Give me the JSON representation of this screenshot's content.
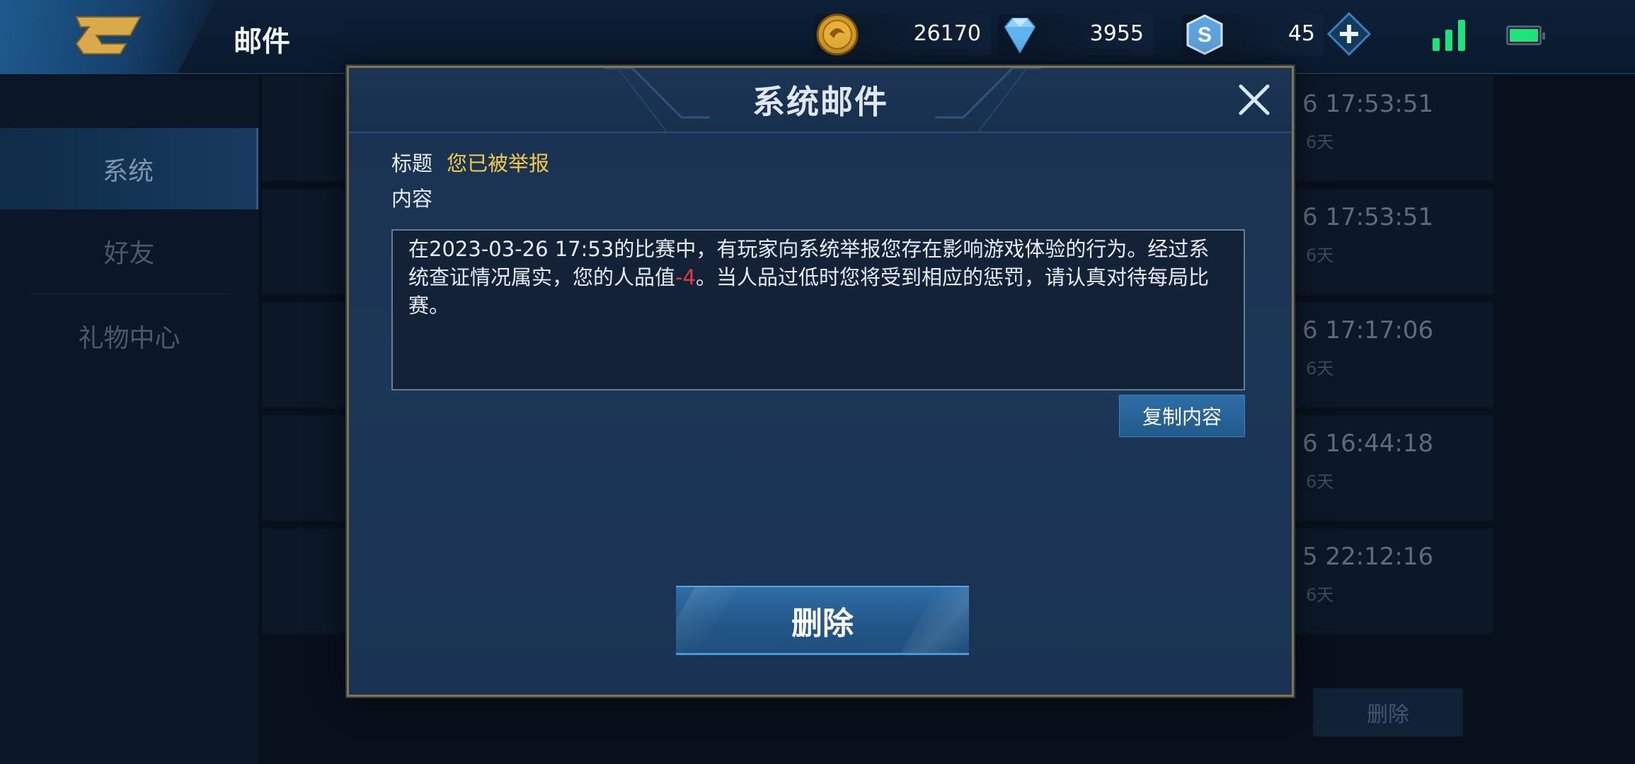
{
  "topbar": {
    "title": "邮件",
    "gold": "26170",
    "diamonds": "3955",
    "vouchers": "45"
  },
  "sidebar": {
    "items": [
      {
        "label": "系统",
        "active": true
      },
      {
        "label": "好友",
        "active": false
      },
      {
        "label": "礼物中心",
        "active": false
      }
    ]
  },
  "mail_list": {
    "rows": [
      {
        "time": "6 17:53:51",
        "days": "6天"
      },
      {
        "time": "6 17:53:51",
        "days": "6天"
      },
      {
        "time": "6 17:17:06",
        "days": "6天"
      },
      {
        "time": "6 16:44:18",
        "days": "6天"
      },
      {
        "time": "5 22:12:16",
        "days": "6天"
      }
    ],
    "delete_label": "删除"
  },
  "modal": {
    "title": "系统邮件",
    "subject_label": "标题",
    "subject_value": "您已被举报",
    "content_label": "内容",
    "content_part1": "在2023-03-26 17:53的比赛中，有玩家向系统举报您存在影响游戏体验的行为。经过系统查证情况属实，您的人品值",
    "content_penalty": "-4",
    "content_part2": "。当人品过低时您将受到相应的惩罚，请认真对待每局比赛。",
    "copy_label": "复制内容",
    "delete_label": "删除"
  },
  "colors": {
    "accent_gold": "#f2cb47",
    "penalty_red": "#e23c3c",
    "button_blue": "#2d6ea6",
    "signal_green": "#1ee27a"
  }
}
